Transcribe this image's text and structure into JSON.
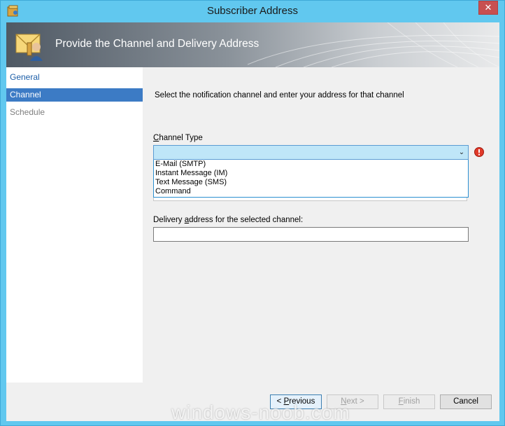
{
  "window": {
    "title": "Subscriber Address",
    "close_label": "✕"
  },
  "banner": {
    "title": "Provide the Channel and Delivery Address"
  },
  "nav": {
    "items": [
      {
        "label": "General",
        "state": "normal"
      },
      {
        "label": "Channel",
        "state": "selected"
      },
      {
        "label": "Schedule",
        "state": "disabled"
      }
    ]
  },
  "content": {
    "instruction": "Select the notification channel and enter your address for that channel",
    "channel_type": {
      "label_prefix": "C",
      "label_rest": "hannel Type",
      "selected_value": "",
      "options": [
        "E-Mail (SMTP)",
        "Instant Message (IM)",
        "Text Message (SMS)",
        "Command"
      ]
    },
    "delivery": {
      "label_before": "Delivery ",
      "label_accel": "a",
      "label_after": "ddress for the selected channel:",
      "value": ""
    }
  },
  "footer": {
    "previous": {
      "before": "< ",
      "accel": "P",
      "after": "revious"
    },
    "next": {
      "accel": "N",
      "after": "ext >"
    },
    "finish": {
      "accel": "F",
      "after": "inish"
    },
    "cancel": "Cancel"
  },
  "watermark": "windows-noob.com",
  "colors": {
    "titlebar": "#61c8ef",
    "selection": "#3c7bc5",
    "combo_focus": "#bfe6f8",
    "error": "#e03a2a"
  }
}
